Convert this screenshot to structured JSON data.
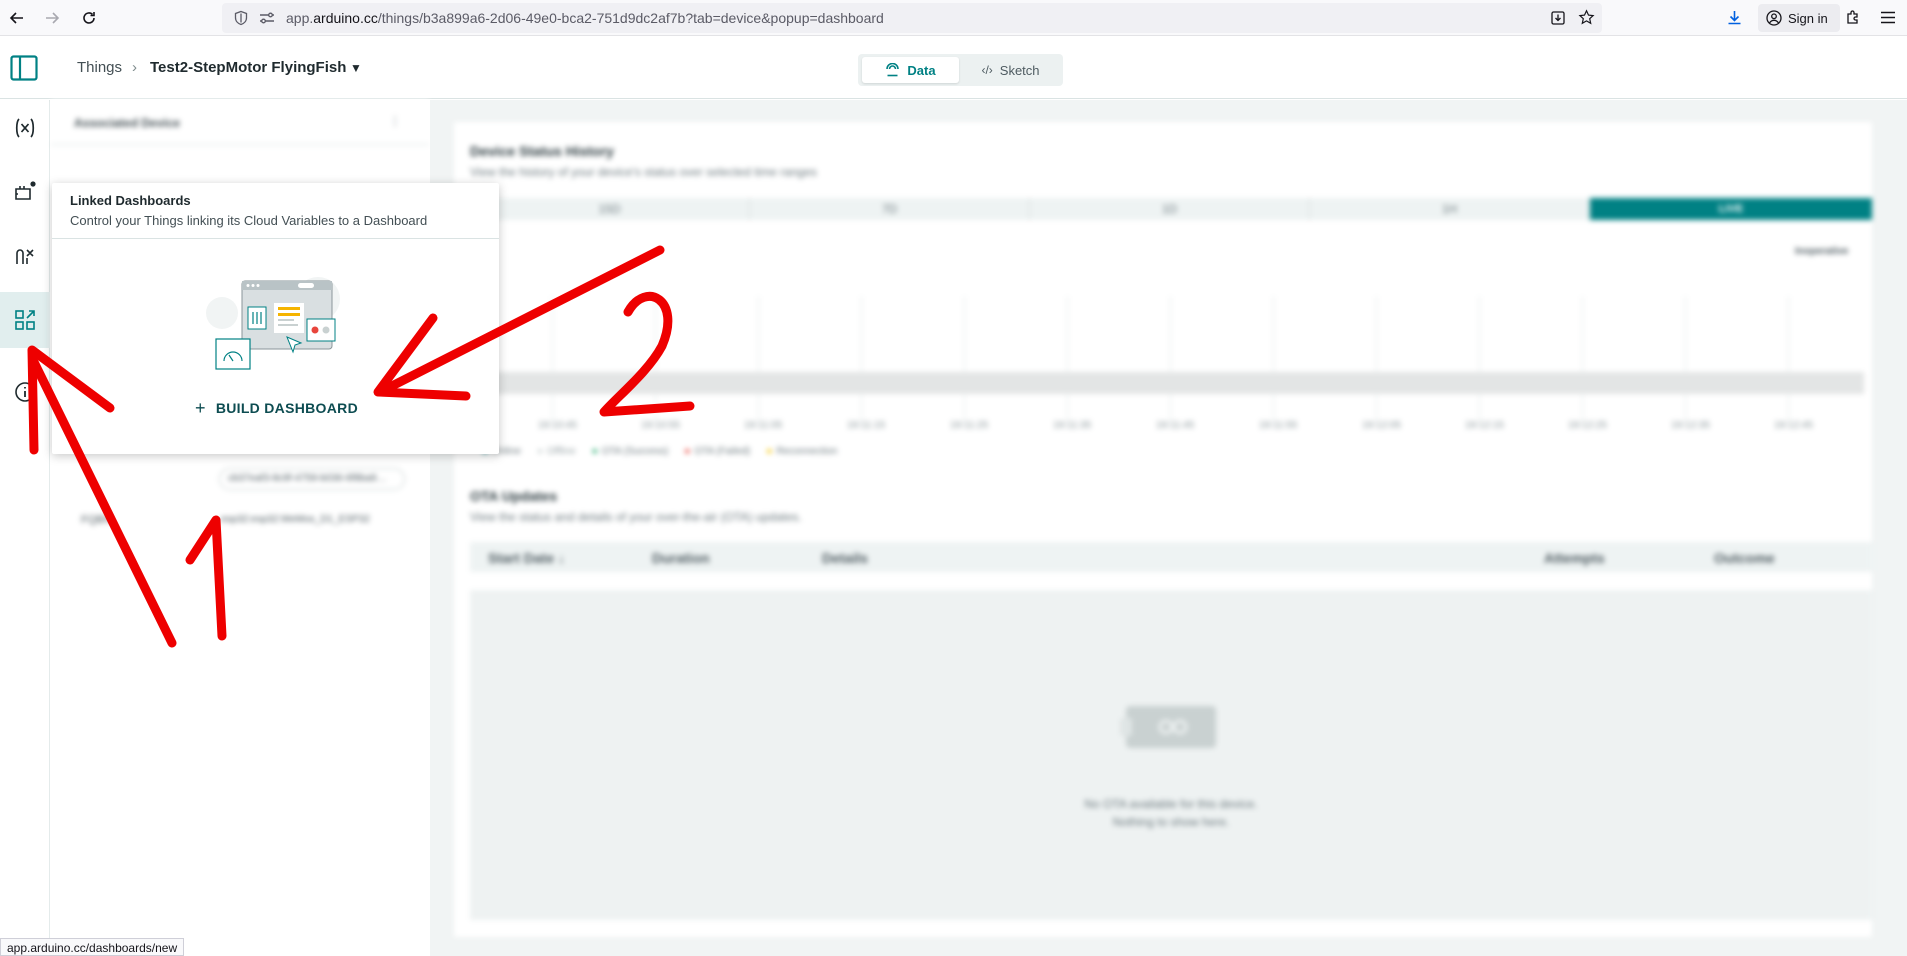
{
  "browser": {
    "url_prefix": "app.",
    "url_domain": "arduino.cc",
    "url_path": "/things/b3a899a6-2d06-49e0-bca2-751d9dc2af7b?tab=device&popup=dashboard",
    "sign_in_label": "Sign in",
    "status_url": "app.arduino.cc/dashboards/new"
  },
  "header": {
    "breadcrumb_root": "Things",
    "breadcrumb_separator": "›",
    "breadcrumb_current": "Test2-StepMotor FlyingFish",
    "tabs": [
      {
        "label": "Data"
      },
      {
        "label": "Sketch"
      }
    ]
  },
  "popup": {
    "title": "Linked Dashboards",
    "subtitle": "Control your Things linking its Cloud Variables to a Dashboard",
    "build_button": "BUILD DASHBOARD"
  },
  "background": {
    "associated_device_label": "Associated Device",
    "chip_value": "cb37eaf3-8c9f-4759-b036-6f8ba9…",
    "fqbn_label": "FQBN",
    "fqbn_value": "esp32:esp32:WeMos_D1_ESP32",
    "device_status_title": "Device Status History",
    "device_status_sub": "View the history of your device's status over selected time ranges",
    "ranges": [
      "15D",
      "7D",
      "1D",
      "1H"
    ],
    "live_label": "LIVE",
    "aggregation_label": "Inoperative",
    "time_ticks": [
      "19:10:45",
      "19:10:55",
      "19:11:05",
      "19:11:15",
      "19:11:25",
      "19:11:35",
      "19:11:45",
      "19:11:55",
      "19:12:05",
      "19:12:15",
      "19:12:25",
      "19:12:35",
      "19:12:45"
    ],
    "legend": [
      "Online",
      "Offline",
      "OTA (Success)",
      "OTA (Failed)",
      "Reconnection"
    ],
    "ota_title": "OTA Updates",
    "ota_sub": "View the status and details of your over-the-air (OTA) updates.",
    "table_headers": [
      "Start Date ↓",
      "Duration",
      "Details",
      "Attempts",
      "Outcome"
    ],
    "empty_line1": "No OTA available for this device.",
    "empty_line2": "Nothing to show here."
  },
  "annotations": {
    "label_1": "1",
    "label_2": "2"
  },
  "colors": {
    "accent": "#008184",
    "annotation_red": "#ee0000"
  }
}
